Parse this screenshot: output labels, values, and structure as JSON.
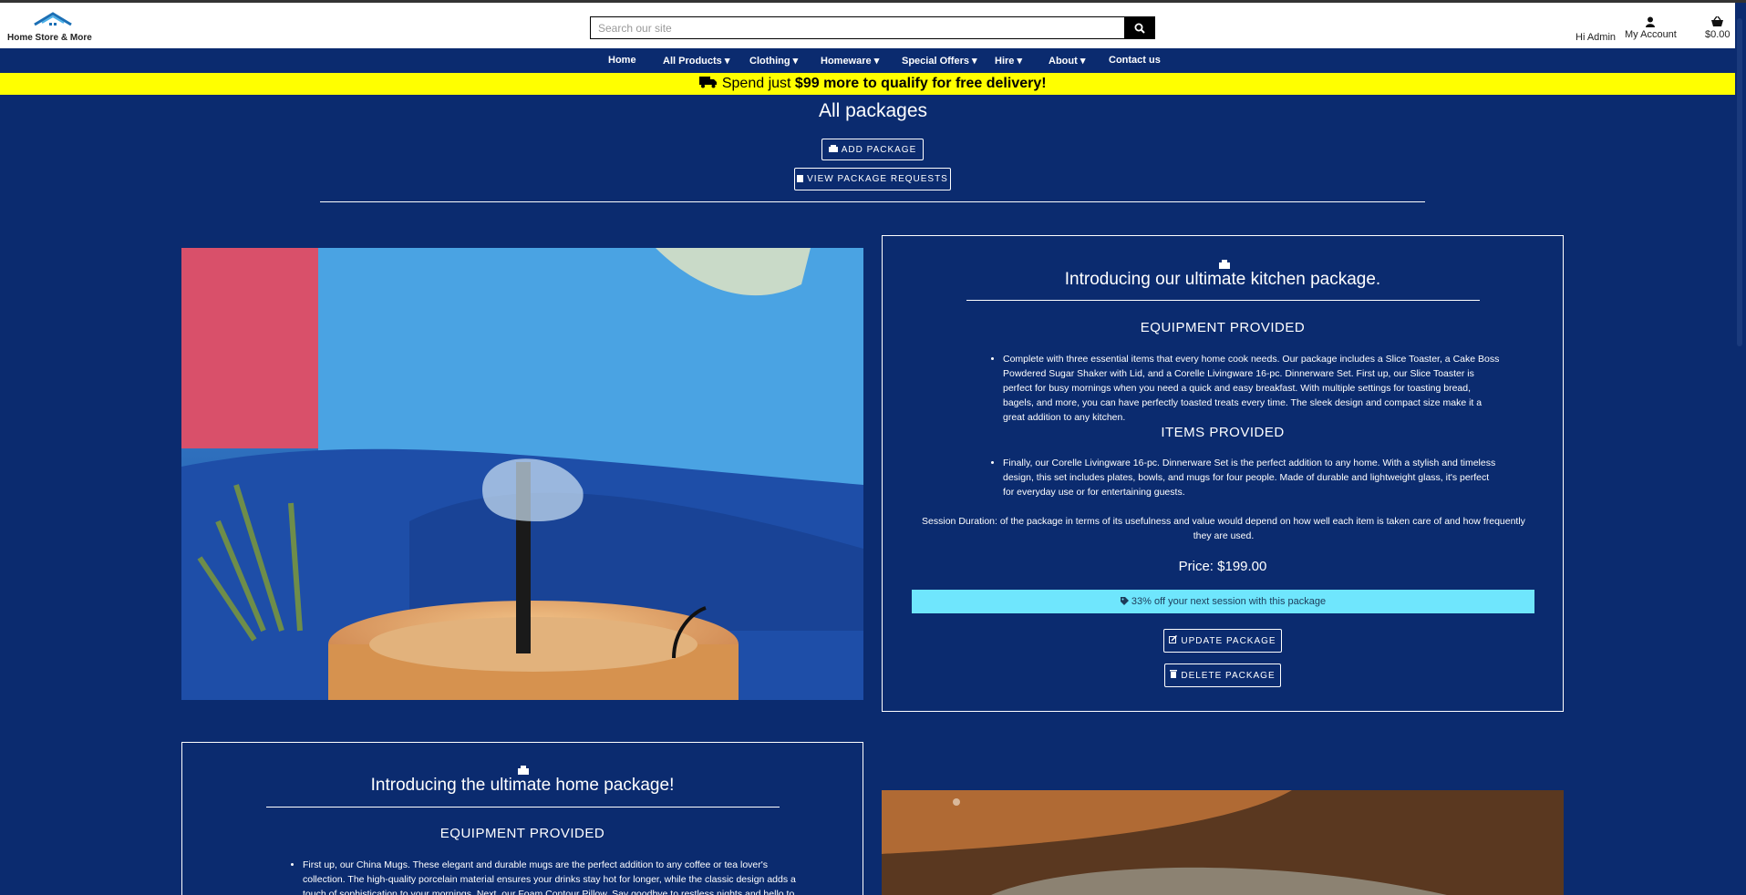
{
  "header": {
    "logo_text": "Home Store & More",
    "search_placeholder": "Search our site",
    "greeting": "Hi Admin",
    "account_label": "My Account",
    "cart_total": "$0.00"
  },
  "nav": {
    "items": [
      {
        "label": "Home",
        "dropdown": false
      },
      {
        "label": "All Products",
        "dropdown": true
      },
      {
        "label": "Clothing",
        "dropdown": true
      },
      {
        "label": "Homeware",
        "dropdown": true
      },
      {
        "label": "Special Offers",
        "dropdown": true
      },
      {
        "label": "Hire",
        "dropdown": true
      },
      {
        "label": "About",
        "dropdown": true
      },
      {
        "label": "Contact us",
        "dropdown": false
      }
    ]
  },
  "banner": {
    "prefix": "Spend just ",
    "amount": "$99 more to qualify for free delivery!"
  },
  "page": {
    "title": "All packages",
    "add_button": "Add Package",
    "view_requests_button": "View Package Requests"
  },
  "packages": [
    {
      "title": "Introducing our ultimate kitchen package.",
      "equipment_heading": "EQUIPMENT PROVIDED",
      "equipment_text": "Complete with three essential items that every home cook needs. Our package includes a Slice Toaster, a Cake Boss Powdered Sugar Shaker with Lid, and a Corelle Livingware 16-pc. Dinnerware Set. First up, our Slice Toaster is perfect for busy mornings when you need a quick and easy breakfast. With multiple settings for toasting bread, bagels, and more, you can have perfectly toasted treats every time. The sleek design and compact size make it a great addition to any kitchen.",
      "items_heading": "ITEMS PROVIDED",
      "items_text": "Finally, our Corelle Livingware 16-pc. Dinnerware Set is the perfect addition to any home. With a stylish and timeless design, this set includes plates, bowls, and mugs for four people. Made of durable and lightweight glass, it's perfect for everyday use or for entertaining guests.",
      "session_text": "Session Duration: of the package in terms of its usefulness and value would depend on how well each item is taken care of and how frequently they are used.",
      "price": "Price: $199.00",
      "discount": "33% off your next session with this package",
      "update_button": "Update Package",
      "delete_button": "Delete Package"
    },
    {
      "title": "Introducing the ultimate home package!",
      "equipment_heading": "EQUIPMENT PROVIDED",
      "equipment_text": "First up, our China Mugs. These elegant and durable mugs are the perfect addition to any coffee or tea lover's collection. The high-quality porcelain material ensures your drinks stay hot for longer, while the classic design adds a touch of sophistication to your mornings. Next, our Foam Contour Pillow. Say goodbye to restless nights and hello to blissful sleep."
    }
  ],
  "colors": {
    "background": "#0b2b6f",
    "banner": "#ffff00",
    "discount": "#6fe6fd"
  }
}
